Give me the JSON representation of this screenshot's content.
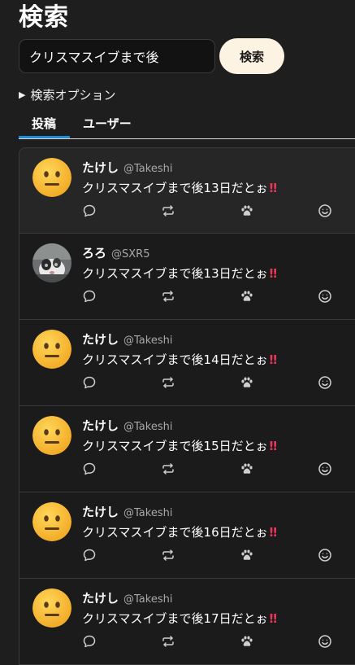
{
  "header": {
    "title": "検索"
  },
  "search": {
    "value": "クリスマスイブまで後",
    "button_label": "検索"
  },
  "options": {
    "label": "検索オプション",
    "marker": "▶"
  },
  "tabs": [
    {
      "label": "投稿",
      "active": true
    },
    {
      "label": "ユーザー",
      "active": false
    }
  ],
  "colors": {
    "background": "#1e1e1e",
    "accent": "#1d8cd8",
    "button_bg": "#fdf3e3",
    "exclamation": "#e8375a"
  },
  "icons": {
    "reply": "speech-bubble-icon",
    "repost": "repost-icon",
    "reaction": "paw-icon",
    "emoji": "smiley-icon"
  },
  "posts": [
    {
      "name": "たけし",
      "handle": "@Takeshi",
      "text": "クリスマスイブまで後13日だとぉ",
      "mark": "‼",
      "avatar": "neutral-face"
    },
    {
      "name": "ろろ",
      "handle": "@SXR5",
      "text": "クリスマスイブまで後13日だとぉ",
      "mark": "‼",
      "avatar": "photo"
    },
    {
      "name": "たけし",
      "handle": "@Takeshi",
      "text": "クリスマスイブまで後14日だとぉ",
      "mark": "‼",
      "avatar": "neutral-face"
    },
    {
      "name": "たけし",
      "handle": "@Takeshi",
      "text": "クリスマスイブまで後15日だとぉ",
      "mark": "‼",
      "avatar": "neutral-face"
    },
    {
      "name": "たけし",
      "handle": "@Takeshi",
      "text": "クリスマスイブまで後16日だとぉ",
      "mark": "‼",
      "avatar": "neutral-face"
    },
    {
      "name": "たけし",
      "handle": "@Takeshi",
      "text": "クリスマスイブまで後17日だとぉ",
      "mark": "‼",
      "avatar": "neutral-face"
    }
  ]
}
